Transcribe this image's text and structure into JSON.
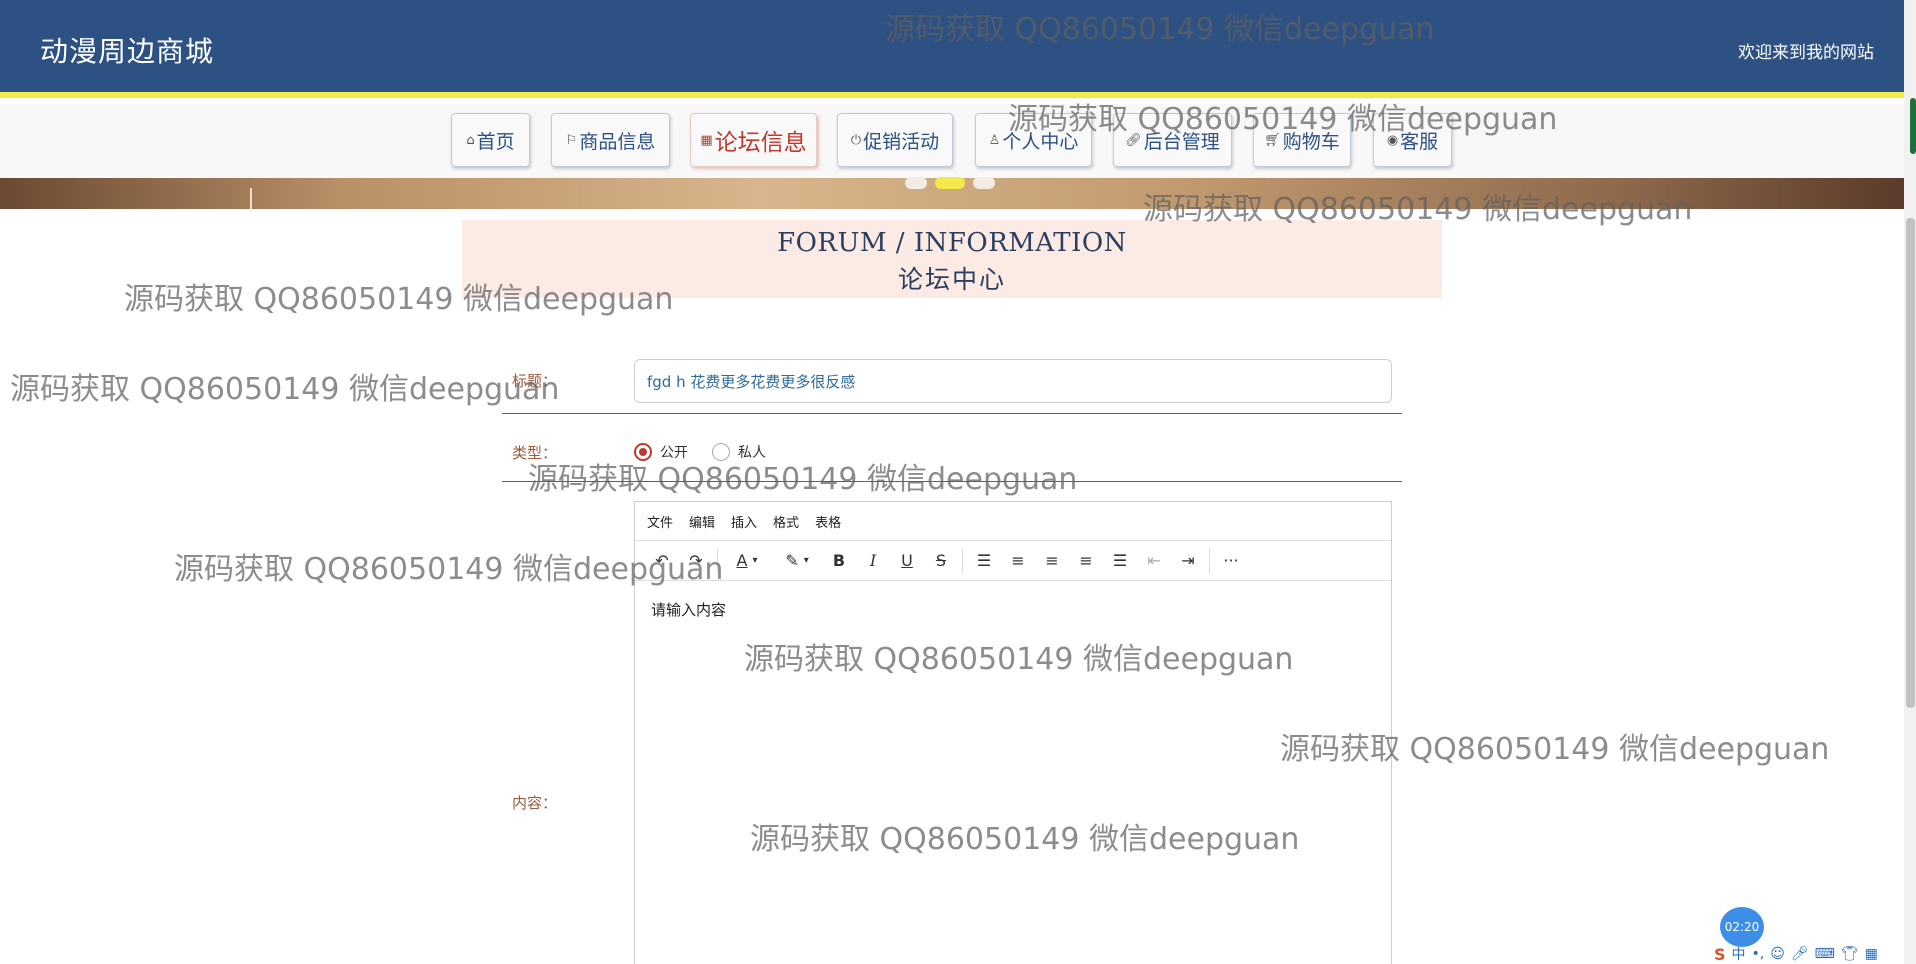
{
  "header": {
    "site_title": "动漫周边商城",
    "welcome": "欢迎来到我的网站"
  },
  "nav": {
    "items": [
      {
        "label": "首页",
        "icon": "home-icon"
      },
      {
        "label": "商品信息",
        "icon": "flag-icon"
      },
      {
        "label": "论坛信息",
        "icon": "grid-icon",
        "active": true
      },
      {
        "label": "促销活动",
        "icon": "power-icon"
      },
      {
        "label": "个人中心",
        "icon": "user-icon"
      },
      {
        "label": "后台管理",
        "icon": "link-icon"
      },
      {
        "label": "购物车",
        "icon": "cart-icon"
      },
      {
        "label": "客服",
        "icon": "globe-icon"
      }
    ]
  },
  "section": {
    "title_en": "FORUM / INFORMATION",
    "title_cn": "论坛中心"
  },
  "form": {
    "title_label": "标题：",
    "title_value": "fgd h 花费更多花费更多很反感",
    "type_label": "类型：",
    "type_options": [
      {
        "label": "公开",
        "checked": true
      },
      {
        "label": "私人",
        "checked": false
      }
    ],
    "content_label": "内容：",
    "editor": {
      "menu": [
        "文件",
        "编辑",
        "插入",
        "格式",
        "表格"
      ],
      "placeholder": "请输入内容",
      "toolbar": [
        "undo-icon",
        "redo-icon",
        "font-color-icon",
        "highlight-icon",
        "bold-icon",
        "italic-icon",
        "underline-icon",
        "strikethrough-icon",
        "line-height-icon",
        "align-left-icon",
        "align-center-icon",
        "align-right-icon",
        "justify-icon",
        "outdent-icon",
        "indent-icon",
        "more-icon"
      ]
    }
  },
  "watermark": "源码获取 QQ86050149 微信deepguan",
  "overlay": {
    "clock": "02:20",
    "ime": "中"
  },
  "colors": {
    "header_bg": "#2d5183",
    "accent_yellow": "#f2e94a",
    "active_nav": "#c0392b",
    "section_bg": "#fcebe4",
    "label": "#9b5a3c"
  }
}
